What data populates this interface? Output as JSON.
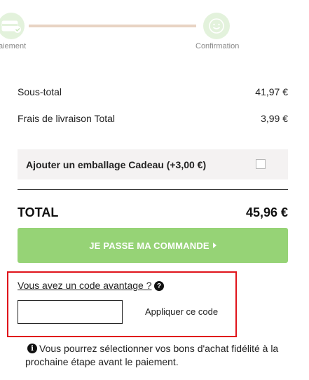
{
  "stepper": {
    "steps": [
      {
        "label": "aiement"
      },
      {
        "label": "Confirmation"
      }
    ]
  },
  "summary": {
    "subtotal_label": "Sous-total",
    "subtotal_value": "41,97 €",
    "shipping_label": "Frais de livraison Total",
    "shipping_value": "3,99 €"
  },
  "gift": {
    "label": "Ajouter un emballage Cadeau (+3,00 €)",
    "checked": false
  },
  "total": {
    "label": "TOTAL",
    "value": "45,96 €"
  },
  "order_button": {
    "label": "JE PASSE MA COMMANDE"
  },
  "coupon": {
    "link_label": "Vous avez un code avantage ?",
    "help_icon": "?",
    "input_value": "",
    "apply_label": "Appliquer ce code"
  },
  "info": {
    "icon": "i",
    "text": "Vous pourrez sélectionner vos bons d'achat fidélité à la prochaine étape avant le paiement."
  },
  "colors": {
    "accent_green": "#96d376",
    "step_circle": "#e3f2dc",
    "step_line": "#e8d3c3",
    "highlight_red": "#e0141b"
  }
}
